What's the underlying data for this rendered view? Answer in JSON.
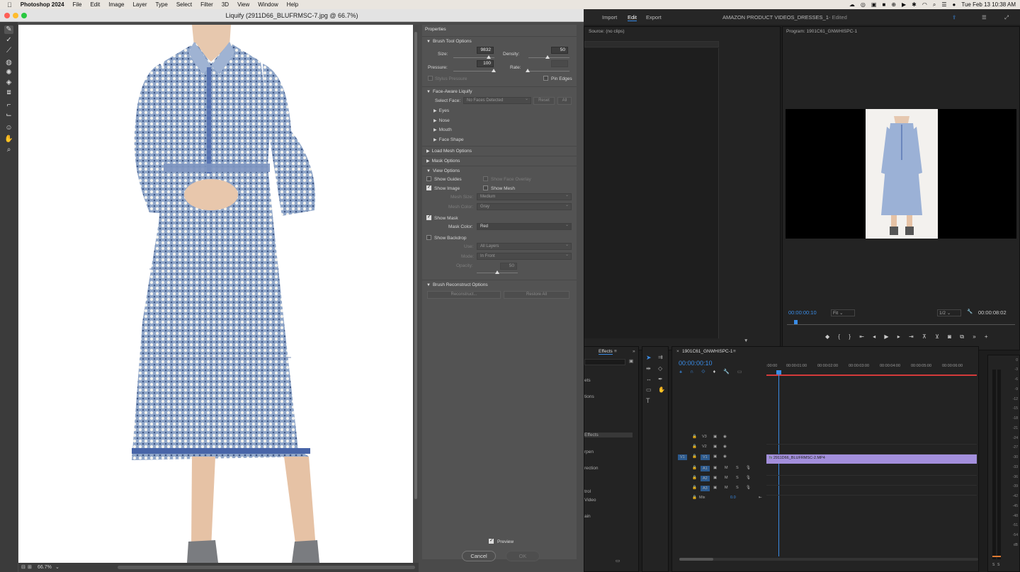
{
  "menubar": {
    "apple_icon": "apple-icon",
    "app_name": "Photoshop 2024",
    "items": [
      "File",
      "Edit",
      "Image",
      "Layer",
      "Type",
      "Select",
      "Filter",
      "3D",
      "View",
      "Window",
      "Help"
    ],
    "clock": "Tue Feb 13  10:38 AM"
  },
  "liquify": {
    "title": "Liquify (2911D66_BLUFRMSC-7.jpg @ 66.7%)",
    "zoom": "66.7%",
    "properties_header": "Properties",
    "brush_tool_options": {
      "title": "Brush Tool Options",
      "size_label": "Size:",
      "size_value": "9832",
      "density_label": "Density:",
      "density_value": "50",
      "pressure_label": "Pressure:",
      "pressure_value": "100",
      "rate_label": "Rate:",
      "rate_value": "",
      "stylus_pressure": "Stylus Pressure",
      "pin_edges": "Pin Edges"
    },
    "face_aware": {
      "title": "Face-Aware Liquify",
      "select_face_label": "Select Face:",
      "select_face_value": "No Faces Detected",
      "reset": "Reset",
      "all": "All",
      "items": [
        "Eyes",
        "Nose",
        "Mouth",
        "Face Shape"
      ]
    },
    "load_mesh": "Load Mesh Options",
    "mask_options": "Mask Options",
    "view_options": {
      "title": "View Options",
      "show_guides": "Show Guides",
      "show_face_overlay": "Show Face Overlay",
      "show_image": "Show Image",
      "show_mesh": "Show Mesh",
      "mesh_size_label": "Mesh Size:",
      "mesh_size_value": "Medium",
      "mesh_color_label": "Mesh Color:",
      "mesh_color_value": "Gray",
      "show_mask": "Show Mask",
      "mask_color_label": "Mask Color:",
      "mask_color_value": "Red",
      "show_backdrop": "Show Backdrop",
      "use_label": "Use:",
      "use_value": "All Layers",
      "mode_label": "Mode:",
      "mode_value": "In Front",
      "opacity_label": "Opacity:",
      "opacity_value": "50"
    },
    "reconstruct": {
      "title": "Brush Reconstruct Options",
      "reconstruct": "Reconstruct...",
      "restore_all": "Restore All"
    },
    "preview": "Preview",
    "cancel": "Cancel",
    "ok": "OK"
  },
  "premiere": {
    "tabs": [
      "Import",
      "Edit",
      "Export"
    ],
    "project_title": "AMAZON PRODUCT VIDEOS_DRESSES_1",
    "edited": "- Edited",
    "source_label": "Source: (no clips)",
    "program_label": "Program: 1901C61_GNWHISPC-1",
    "program_timecode": "00:00:00:10",
    "fit": "Fit",
    "resolution": "1/2",
    "duration": "00:00:08:02",
    "effects_tab": "Effects",
    "effects_items": [
      "ets",
      "tions",
      "Effects",
      "rpen",
      "rection",
      "trol",
      "Video",
      "ain"
    ],
    "sequence_tab": "1901C61_GNWHISPC-1",
    "seq_timecode": "00:00:00:10",
    "ruler": [
      ":00:00",
      "00:00:01:00",
      "00:00:02:00",
      "00:00:03:00",
      "00:00:04:00",
      "00:00:05:00",
      "00:00:06:00"
    ],
    "video_tracks": [
      "V3",
      "V2",
      "V1"
    ],
    "audio_tracks": [
      "A1",
      "A2",
      "A3"
    ],
    "mix_label": "Mix",
    "mix_value": "0.0",
    "clip_name": "2911D66_BLUFRMSC-2.MP4",
    "meter_labels": [
      "0",
      "-3",
      "-6",
      "-9",
      "-12",
      "-15",
      "-18",
      "-21",
      "-24",
      "-27",
      "-30",
      "-33",
      "-36",
      "-39",
      "-42",
      "-45",
      "-48",
      "-51",
      "-54",
      "dB"
    ],
    "solo_labels": [
      "S",
      "S"
    ]
  }
}
